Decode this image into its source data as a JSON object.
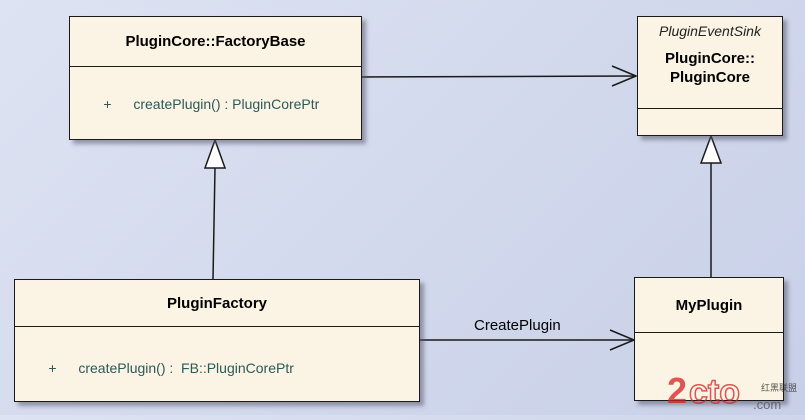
{
  "classes": {
    "factory_base": {
      "name": "PluginCore::FactoryBase",
      "operations": [
        {
          "visibility": "+",
          "signature": "createPlugin() : PluginCorePtr"
        }
      ]
    },
    "plugin_core": {
      "stereotype": "PluginEventSink",
      "name_line1": "PluginCore::",
      "name_line2": "PluginCore"
    },
    "plugin_factory": {
      "name": "PluginFactory",
      "operations": [
        {
          "visibility": "+",
          "signature": "createPlugin() :  FB::PluginCorePtr"
        }
      ]
    },
    "my_plugin": {
      "name": "MyPlugin"
    }
  },
  "edges": {
    "create_plugin_label": "CreatePlugin"
  },
  "watermark": {
    "logo_text": "2cto",
    "suffix": ".com",
    "cjk": "红黑联盟"
  },
  "colors": {
    "background": "#d0d7ec",
    "class_fill": "#fbf3e3",
    "operation_text": "#2a5a5a",
    "watermark_red": "#d42020"
  }
}
